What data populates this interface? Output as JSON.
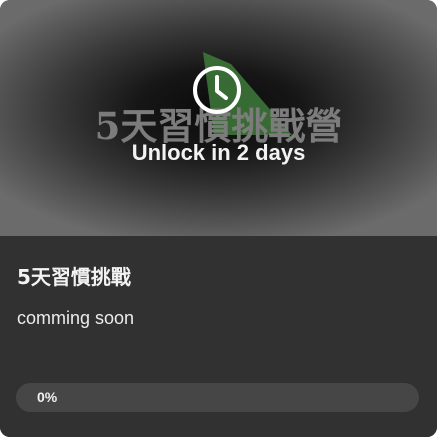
{
  "cover": {
    "title": "5天習慣挑戰營",
    "status_icon": "clock-icon",
    "unlock_text": "Unlock in 2 days"
  },
  "card": {
    "title": "5天習慣挑戰",
    "description": "comming soon"
  },
  "progress": {
    "label": "0%",
    "value": 0
  },
  "colors": {
    "card_background": "#313131",
    "progress_track": "#464646",
    "accent_green": "#3f7a3a"
  }
}
